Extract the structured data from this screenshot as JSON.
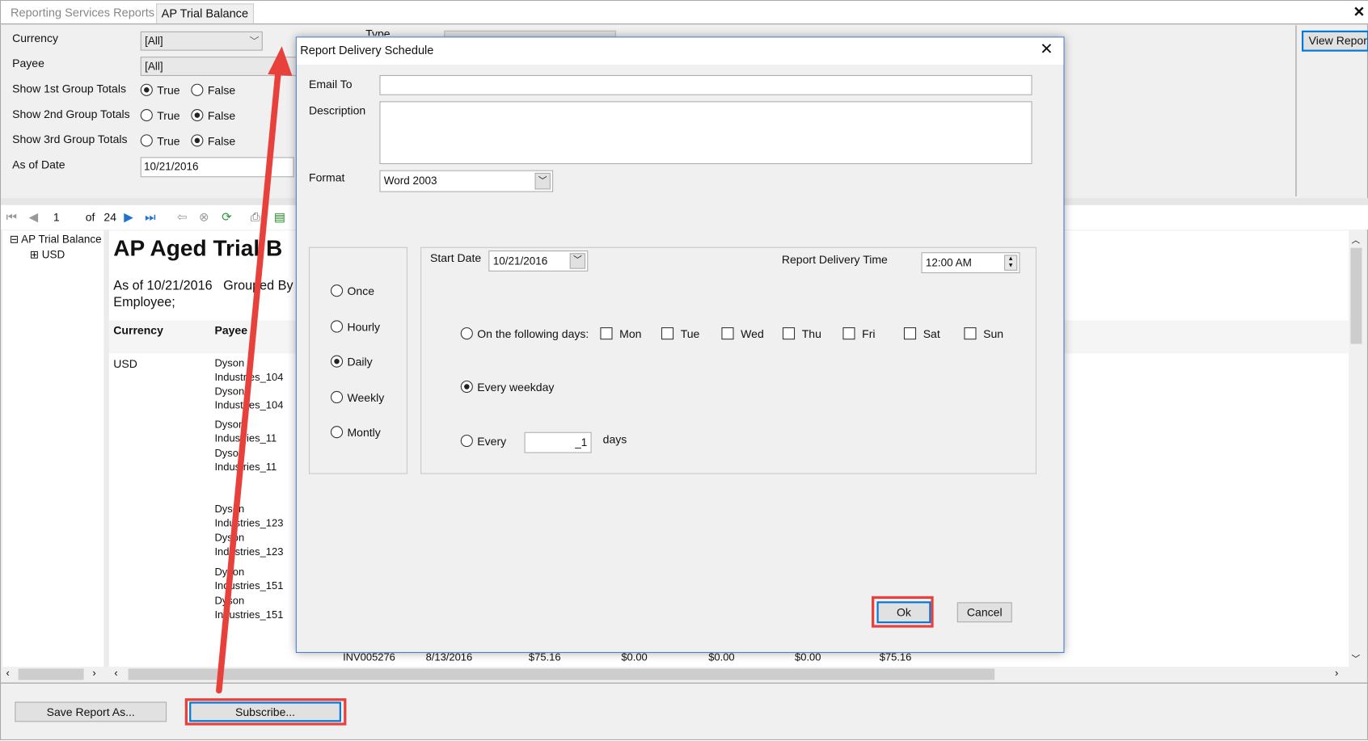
{
  "tabs": [
    {
      "label": "Reporting Services Reports",
      "active": false
    },
    {
      "label": "AP Trial Balance",
      "active": true
    }
  ],
  "close_icon": "close-icon",
  "params": {
    "currency": {
      "label": "Currency",
      "value": "[All]"
    },
    "payee": {
      "label": "Payee",
      "value": "[All]"
    },
    "group1": {
      "label": "Show 1st Group Totals",
      "selected": "True"
    },
    "group2": {
      "label": "Show 2nd Group Totals",
      "selected": "False"
    },
    "group3": {
      "label": "Show 3rd Group Totals",
      "selected": "False"
    },
    "true_label": "True",
    "false_label": "False",
    "as_of_date": {
      "label": "As of Date",
      "value": "10/21/2016"
    },
    "type_label": "Type",
    "view_report": "View Report"
  },
  "toolbar": {
    "page": "1",
    "of_label": "of",
    "total_pages": "24"
  },
  "tree": {
    "root": "AP Trial Balance",
    "child": "USD"
  },
  "report": {
    "title": "AP Aged Trial B",
    "subtitle1": "As of 10/21/2016   Grouped By",
    "subtitle2": "Employee;",
    "headers": [
      "Currency",
      "Payee"
    ],
    "currency": "USD",
    "payee_lines": [
      "Dyson",
      "Industries_104",
      "Dyson",
      "Industries_104",
      "Dyson",
      "Industries_11",
      "Dyson",
      "Industries_11",
      "Dyson",
      "Industries_123",
      "Dyson",
      "Industries_123",
      "Dyson",
      "Industries_151",
      "Dyson",
      "Industries_151"
    ],
    "last_row": [
      "INV005276",
      "8/13/2016",
      "$75.16",
      "$0.00",
      "$0.00",
      "$0.00",
      "$75.16"
    ]
  },
  "bottom": {
    "save_as": "Save Report As...",
    "subscribe": "Subscribe..."
  },
  "dialog": {
    "title": "Report Delivery Schedule",
    "email_label": "Email To",
    "email_value": "",
    "description_label": "Description",
    "description_value": "",
    "format_label": "Format",
    "format_value": "Word 2003",
    "frequency": [
      "Once",
      "Hourly",
      "Daily",
      "Weekly",
      "Montly"
    ],
    "frequency_selected": "Daily",
    "start_date_label": "Start Date",
    "start_date": "10/21/2016",
    "delivery_time_label": "Report Delivery Time",
    "delivery_time": "12:00 AM",
    "following_days_label": "On the following days:",
    "days": [
      "Mon",
      "Tue",
      "Wed",
      "Thu",
      "Fri",
      "Sat",
      "Sun"
    ],
    "every_weekday_label": "Every weekday",
    "every_label": "Every",
    "every_value": "_1",
    "days_label": "days",
    "daily_selected": "Every weekday",
    "ok": "Ok",
    "cancel": "Cancel"
  },
  "colors": {
    "highlight": "#e8413b",
    "dialog_border": "#4a7bd0",
    "focus": "#0078d7"
  }
}
